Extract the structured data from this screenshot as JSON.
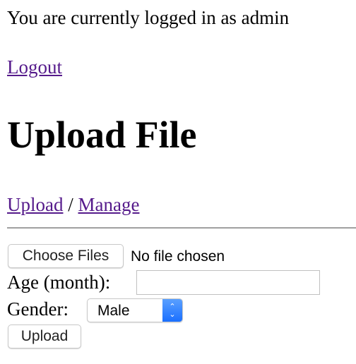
{
  "status": {
    "text": "You are currently logged in as admin"
  },
  "logout_label": "Logout",
  "page_title": "Upload File",
  "nav": {
    "upload": "Upload",
    "separator": "/",
    "manage": "Manage"
  },
  "form": {
    "choose_files_label": "Choose Files",
    "file_status": "No file chosen",
    "age_label": "Age (month):",
    "age_value": "",
    "gender_label": "Gender:",
    "gender_selected": "Male",
    "submit_label": "Upload"
  },
  "colors": {
    "link": "#551a8b",
    "select_accent": "#1a6fff"
  }
}
